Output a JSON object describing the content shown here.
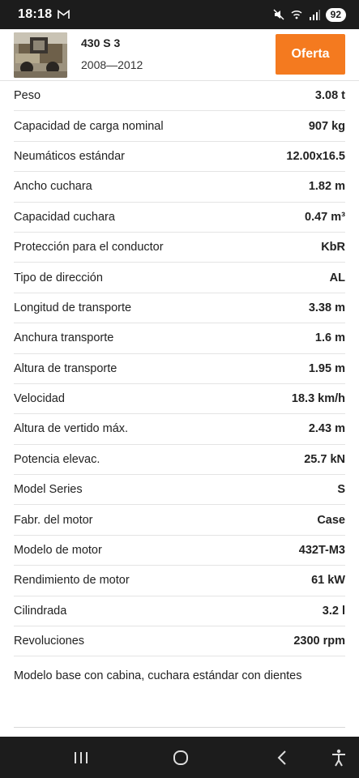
{
  "status_bar": {
    "time": "18:18",
    "battery": "92",
    "icons": [
      "gmail-icon",
      "mute-icon",
      "wifi-icon",
      "signal-icon",
      "battery-icon"
    ]
  },
  "header": {
    "model": "430 S 3",
    "years": "2008—2012",
    "offer_button": "Oferta",
    "offer_color": "#f47a1f"
  },
  "specs": [
    {
      "label": "Peso",
      "value": "3.08 t"
    },
    {
      "label": "Capacidad de carga nominal",
      "value": "907 kg"
    },
    {
      "label": "Neumáticos estándar",
      "value": "12.00x16.5"
    },
    {
      "label": "Ancho cuchara",
      "value": "1.82 m"
    },
    {
      "label": "Capacidad cuchara",
      "value": "0.47 m³"
    },
    {
      "label": "Protección para el conductor",
      "value": "KbR"
    },
    {
      "label": "Tipo de dirección",
      "value": "AL"
    },
    {
      "label": "Longitud de transporte",
      "value": "3.38 m"
    },
    {
      "label": "Anchura transporte",
      "value": "1.6 m"
    },
    {
      "label": "Altura de transporte",
      "value": "1.95 m"
    },
    {
      "label": "Velocidad",
      "value": "18.3 km/h"
    },
    {
      "label": "Altura de vertido máx.",
      "value": "2.43 m"
    },
    {
      "label": "Potencia elevac.",
      "value": "25.7 kN"
    },
    {
      "label": "Model Series",
      "value": "S"
    },
    {
      "label": "Fabr. del motor",
      "value": "Case"
    },
    {
      "label": "Modelo de motor",
      "value": "432T-M3"
    },
    {
      "label": "Rendimiento de motor",
      "value": "61 kW"
    },
    {
      "label": "Cilindrada",
      "value": "3.2 l"
    },
    {
      "label": "Revoluciones",
      "value": "2300 rpm"
    }
  ],
  "description": "Modelo base con cabina, cuchara estándar con dientes",
  "nav_bar": {
    "buttons": [
      "recent-apps-icon",
      "home-icon",
      "back-icon",
      "accessibility-icon"
    ]
  }
}
